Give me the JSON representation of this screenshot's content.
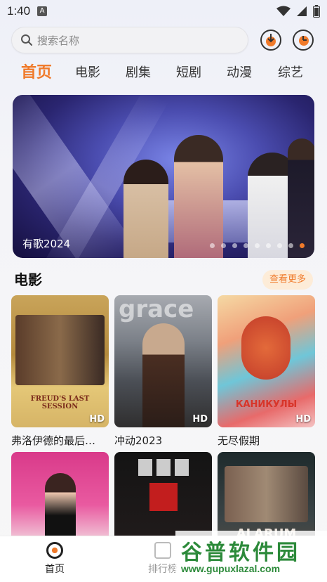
{
  "status_bar": {
    "time": "1:40",
    "notification_badge": "A"
  },
  "search": {
    "placeholder": "搜索名称"
  },
  "tabs": [
    {
      "label": "首页",
      "active": true
    },
    {
      "label": "电影"
    },
    {
      "label": "剧集"
    },
    {
      "label": "短剧"
    },
    {
      "label": "动漫"
    },
    {
      "label": "综艺"
    }
  ],
  "banner": {
    "title": "有歌2024",
    "slide_count": 9,
    "active_slide": 9
  },
  "movies": {
    "section_title": "电影",
    "more_label": "查看更多",
    "items": [
      {
        "title": "弗洛伊德的最后…",
        "badge": "HD",
        "poster_text": "FREUD'S LAST SESSION"
      },
      {
        "title": "冲动2023",
        "badge": "HD",
        "poster_text": "grace"
      },
      {
        "title": "无尽假期",
        "badge": "HD",
        "poster_text": "КАНИКУЛЫ"
      },
      {
        "title": "",
        "badge": ""
      },
      {
        "title": "",
        "badge": ""
      },
      {
        "title": "",
        "badge": "",
        "poster_text": "ALARUM"
      }
    ]
  },
  "bottom_nav": [
    {
      "label": "首页",
      "active": true
    },
    {
      "label": "排行榜"
    }
  ],
  "watermark": {
    "text": "谷普软件园",
    "url": "www.gupuxlazal.com"
  },
  "colors": {
    "accent": "#f07a2a",
    "watermark": "#2c8a3a"
  }
}
